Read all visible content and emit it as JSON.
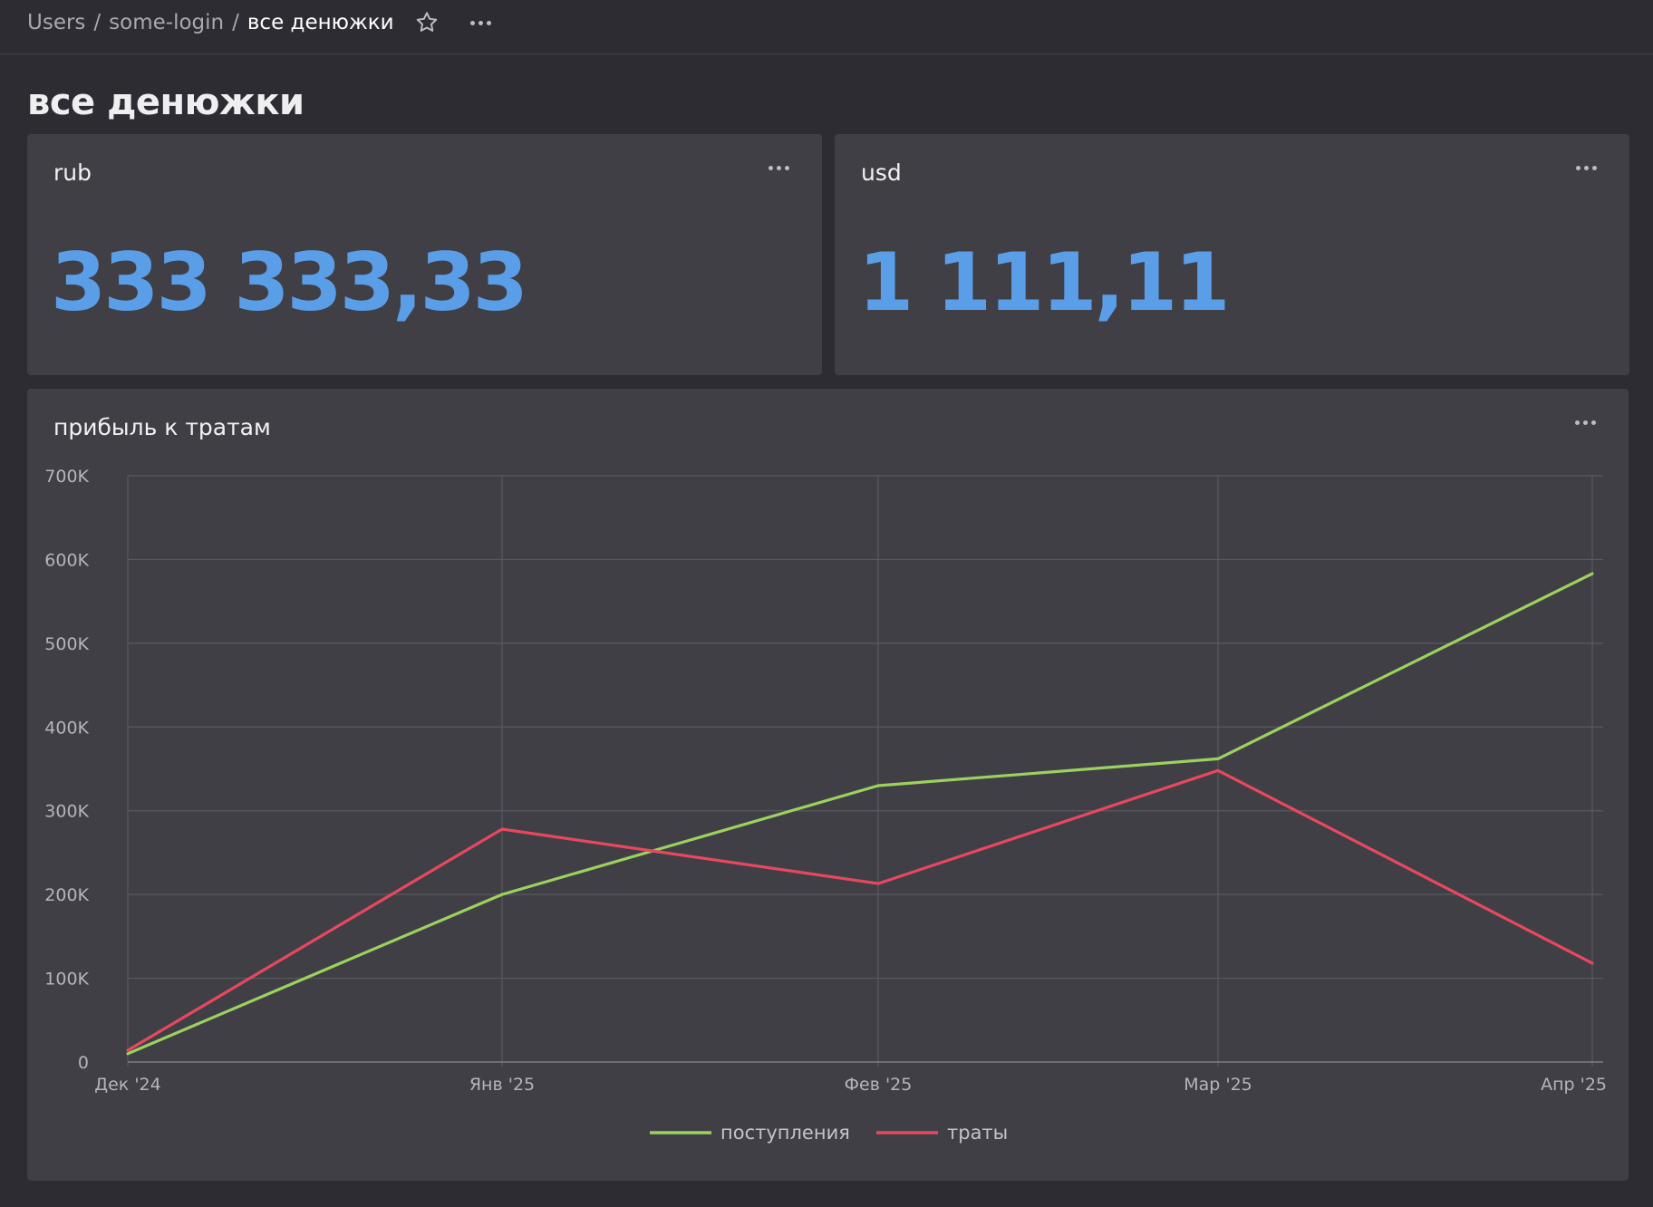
{
  "breadcrumb": {
    "items": [
      "Users",
      "some-login"
    ],
    "current": "все денюжки",
    "separator": "/"
  },
  "page": {
    "title": "все денюжки"
  },
  "cards": [
    {
      "title": "rub",
      "value": "333 333,33"
    },
    {
      "title": "usd",
      "value": "1 111,11"
    }
  ],
  "chart_card": {
    "title": "прибыль к тратам"
  },
  "icons": {
    "favorite": "star-icon",
    "more": "more-dots-icon"
  },
  "colors": {
    "accent": "#5b9ee8",
    "income": "#9bd25e",
    "expenses": "#e8485f"
  },
  "chart_data": {
    "type": "line",
    "title": "прибыль к тратам",
    "x": [
      "Дек '24",
      "Янв '25",
      "Фев '25",
      "Мар '25",
      "Апр '25"
    ],
    "ylim": [
      0,
      700000
    ],
    "yticks": [
      0,
      100000,
      200000,
      300000,
      400000,
      500000,
      600000,
      700000
    ],
    "ytick_labels": [
      "0",
      "100K",
      "200K",
      "300K",
      "400K",
      "500K",
      "600K",
      "700K"
    ],
    "grid": true,
    "legend": "bottom-center",
    "series": [
      {
        "name": "поступления",
        "color": "#9bd25e",
        "values": [
          10000,
          200000,
          330000,
          362000,
          583000
        ]
      },
      {
        "name": "траты",
        "color": "#e8485f",
        "values": [
          14000,
          278000,
          213000,
          348000,
          118000
        ]
      }
    ]
  }
}
